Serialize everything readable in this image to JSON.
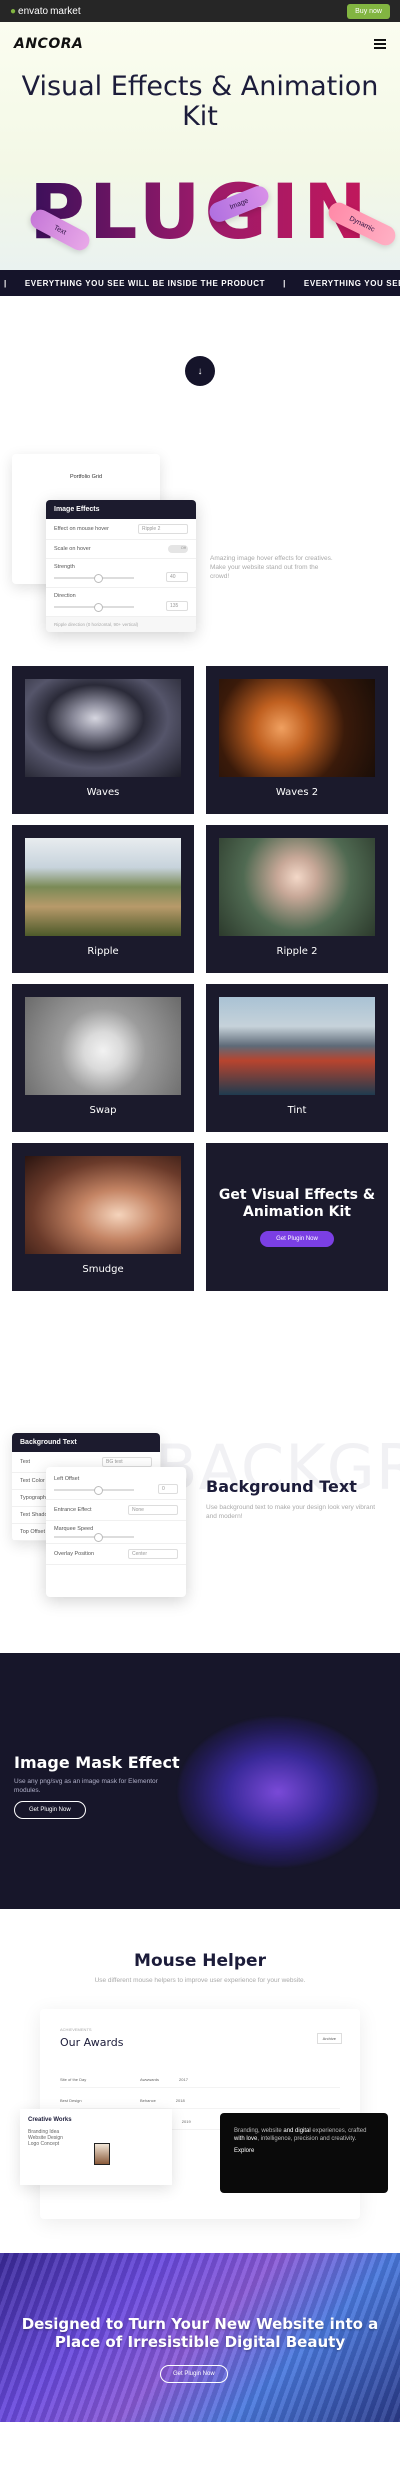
{
  "topbar": {
    "brand_left": "envato",
    "brand_right": "market",
    "buy_label": "Buy now"
  },
  "nav": {
    "logo": "ANCORA"
  },
  "hero": {
    "title": "Visual Effects & Animation Kit",
    "plugin_word": "PLUGIN",
    "pills": [
      "Text",
      "Image",
      "Dynamic"
    ]
  },
  "marquee": {
    "text": "EVERYTHING YOU SEE WILL BE INSIDE THE PRODUCT",
    "separator": "|"
  },
  "scroll": {
    "icon": "arrow-down-icon",
    "glyph": "↓"
  },
  "effects_panel": {
    "back_title": "Portfolio Grid",
    "title": "Image Effects",
    "rows": [
      {
        "label": "Effect on mouse hover",
        "value": "Ripple 2"
      },
      {
        "label": "Scale on hover",
        "value": "Off"
      },
      {
        "label": "Strength",
        "value": "40"
      },
      {
        "label": "Direction",
        "value": "135"
      }
    ],
    "footer": "Ripple direction (0 horizontal, 90+ vertical)",
    "description": "Amazing image hover effects for creatives. Make your website stand out from the crowd!"
  },
  "cards": [
    {
      "label": "Waves"
    },
    {
      "label": "Waves 2"
    },
    {
      "label": "Ripple"
    },
    {
      "label": "Ripple 2"
    },
    {
      "label": "Swap"
    },
    {
      "label": "Tint"
    },
    {
      "label": "Smudge"
    }
  ],
  "cta_card": {
    "title": "Get Visual Effects & Animation Kit",
    "button": "Get Plugin Now"
  },
  "bg_text": {
    "ghost": "BACKGROUND",
    "panel_title": "Background Text",
    "back_rows": [
      {
        "label": "Text",
        "value": "BG text"
      },
      {
        "label": "Text Color",
        "value": ""
      },
      {
        "label": "Typography",
        "value": ""
      },
      {
        "label": "Text Shadow",
        "value": ""
      },
      {
        "label": "Top Offset",
        "value": ""
      }
    ],
    "front_rows": [
      {
        "label": "Left Offset",
        "value": "0"
      },
      {
        "label": "Entrance Effect",
        "value": "None"
      },
      {
        "label": "Marquee Speed",
        "value": ""
      },
      {
        "label": "Overlay Position",
        "value": "Center"
      }
    ],
    "title": "Background Text",
    "description": "Use background text to make your design look very vibrant and modern!"
  },
  "image_mask": {
    "title": "Image Mask Effect",
    "description": "Use any png/svg as an image mask for Elementor modules.",
    "button": "Get Plugin Now"
  },
  "mouse_helper": {
    "title": "Mouse Helper",
    "description": "Use different mouse helpers to improve user experience for your website.",
    "awards_small": "ACHIEVEMENTS",
    "awards_title": "Our Awards",
    "awards_button": "Archive",
    "award_rows": [
      {
        "name": "Site of the Day",
        "org": "Awwwards",
        "year": "2017"
      },
      {
        "name": "Best Design",
        "org": "Behance",
        "year": "2018"
      },
      {
        "name": "Website of the Year",
        "org": "CSS Design",
        "year": "2019"
      }
    ],
    "creative_title": "Creative Works",
    "creative_lines": [
      "Branding Idea",
      "Website Design",
      "Logo Concept"
    ],
    "dark_text_a": "Branding, website ",
    "dark_text_b": "and digital",
    "dark_text_c": " experiences, crafted ",
    "dark_text_d": "with love",
    "dark_text_e": ", intelligence, precision and creativity.",
    "dark_link": "Explore"
  },
  "footer_cta": {
    "title": "Designed to Turn Your New Website into a Place of Irresistible Digital Beauty",
    "button": "Get Plugin Now"
  }
}
